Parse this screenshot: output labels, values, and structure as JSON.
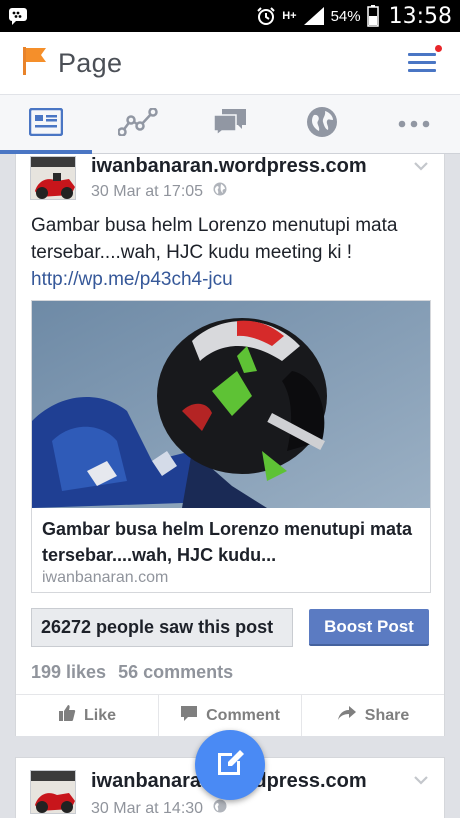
{
  "status_bar": {
    "network": "H+",
    "battery": "54%",
    "time": "13:58",
    "icons": [
      "bbm-icon",
      "alarm-icon",
      "signal-icon",
      "battery-icon"
    ]
  },
  "header": {
    "title": "Page",
    "icons": [
      "flag-icon",
      "menu-icon"
    ],
    "accent": "#4a76c4",
    "notification_color": "#e8262a"
  },
  "tabs": [
    {
      "name": "news-feed-icon",
      "active": true
    },
    {
      "name": "insights-icon",
      "active": false
    },
    {
      "name": "messages-icon",
      "active": false
    },
    {
      "name": "notifications-globe-icon",
      "active": false
    },
    {
      "name": "more-icon",
      "active": false
    }
  ],
  "posts": [
    {
      "author": "iwanbanaran.wordpress.com",
      "timestamp": "30 Mar at 17:05",
      "text": "Gambar busa helm Lorenzo menutupi mata tersebar....wah, HJC kudu meeting ki ! ",
      "link": "http://wp.me/p43ch4-jcu",
      "preview": {
        "title": "Gambar busa helm Lorenzo menutupi mata tersebar....wah, HJC kudu...",
        "domain": "iwanbanaran.com"
      },
      "reach": "26272 people saw this post",
      "boost_label": "Boost Post",
      "likes": "199 likes",
      "comments": "56 comments",
      "actions": {
        "like": "Like",
        "comment": "Comment",
        "share": "Share"
      }
    },
    {
      "author": "iwanbanaran.wordpress.com",
      "timestamp": "30 Mar at 14:30"
    }
  ],
  "colors": {
    "boost": "#5b7bc2",
    "fab": "#4a8af4",
    "link": "#365899"
  }
}
